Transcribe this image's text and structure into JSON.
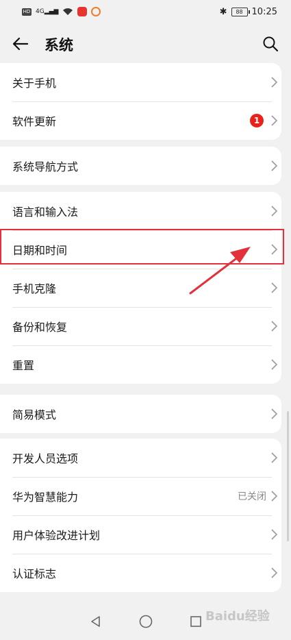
{
  "statusbar": {
    "time": "10:25",
    "battery": "88",
    "signal_label": "4G"
  },
  "header": {
    "title": "系统"
  },
  "groups": [
    {
      "items": [
        {
          "label": "关于手机"
        },
        {
          "label": "软件更新",
          "badge": "1"
        }
      ]
    },
    {
      "items": [
        {
          "label": "系统导航方式"
        }
      ]
    },
    {
      "items": [
        {
          "label": "语言和输入法"
        },
        {
          "label": "日期和时间"
        },
        {
          "label": "手机克隆"
        },
        {
          "label": "备份和恢复"
        },
        {
          "label": "重置"
        }
      ]
    },
    {
      "items": [
        {
          "label": "简易模式"
        }
      ]
    },
    {
      "items": [
        {
          "label": "开发人员选项"
        },
        {
          "label": "华为智慧能力",
          "value": "已关闭"
        },
        {
          "label": "用户体验改进计划"
        },
        {
          "label": "认证标志"
        }
      ]
    }
  ],
  "watermark": "Baidu经验",
  "colors": {
    "highlight": "#e3303a",
    "badge": "#e8221b",
    "background": "#f1f1f1"
  },
  "icons": [
    "back-arrow-icon",
    "search-icon",
    "chevron-right-icon",
    "nav-back-icon",
    "nav-home-icon",
    "nav-recent-icon"
  ]
}
